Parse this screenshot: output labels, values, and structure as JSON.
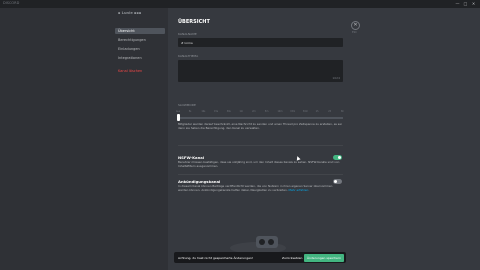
{
  "app": {
    "title": "DISCORD"
  },
  "window": {
    "minimize": "—",
    "maximize": "□",
    "close": "✕"
  },
  "sidebar": {
    "header": "▪ Lunie ▪▪▪",
    "items": [
      {
        "label": "Übersicht",
        "active": true
      },
      {
        "label": "Berechtigungen"
      },
      {
        "label": "Einladungen"
      },
      {
        "label": "Integrationen"
      },
      {
        "label": "Kanal löschen",
        "danger": true
      }
    ]
  },
  "main": {
    "heading": "ÜBERSICHT",
    "name_label": "Kanalname",
    "name_value": "# loima",
    "topic_label": "Kanalthema",
    "topic_counter": "1024",
    "slowmode_label": "Slowmode",
    "slowmode_ticks": [
      "Aus",
      "5s",
      "10s",
      "15s",
      "30s",
      "1m",
      "2m",
      "5m",
      "10m",
      "15m",
      "30m",
      "1h",
      "2h",
      "6h"
    ],
    "slowmode_value": 0,
    "slowmode_desc": "Mitglieder werden darauf beschränkt, eine Nachricht zu senden und einen Thread pro Zeitspanne zu erstellen, es sei denn sie haben die Berechtigung, den Kanal zu verwalten.",
    "nsfw_label": "NSFW-Kanal",
    "nsfw_desc": "Benutzer müssen bestätigen, dass sie volljährig sind, um den Inhalt dieses Kanals zu sehen. NSFW-Kanäle sind von Inhaltsfiltern ausgenommen.",
    "nsfw_on": true,
    "announce_label": "Ankündigungskanal",
    "announce_desc": "In diesem Kanal können Beiträge veröffentlicht werden, die von Nutzern in ihren eigenen Server übernommen werden können. Ankündigungskanäle helfen dabei, Neuigkeiten zu verbreiten.",
    "announce_link": "Mehr erfahren",
    "announce_on": false
  },
  "esc": {
    "icon": "✕",
    "label": "ESC"
  },
  "notice": {
    "text": "Achtung, du hast nicht gespeicherte Änderungen!",
    "reset": "Zurücksetzen",
    "save": "Änderungen speichern"
  },
  "colors": {
    "accent": "#7289da",
    "green": "#43b581",
    "danger": "#f04747"
  }
}
